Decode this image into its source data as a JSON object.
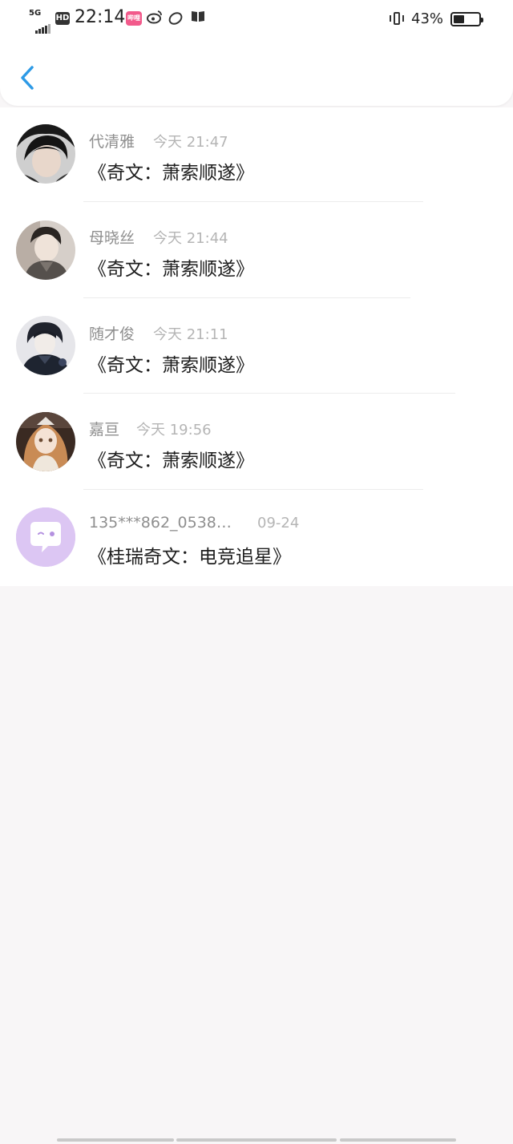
{
  "status_bar": {
    "network": "5G",
    "hd_badge": "HD",
    "time": "22:14",
    "app_badge": "哔哩",
    "battery_percent": "43%",
    "battery_level": 0.43
  },
  "nav": {
    "back_icon": "chevron-left-icon",
    "accent_color": "#2d9ae6"
  },
  "conversations": [
    {
      "name": "代清雅",
      "time": "今天 21:47",
      "message": "《奇文：萧索顺遂》",
      "avatar": "photo-avatar"
    },
    {
      "name": "母晓丝",
      "time": "今天 21:44",
      "message": "《奇文：萧索顺遂》",
      "avatar": "photo-avatar"
    },
    {
      "name": "随才俊",
      "time": "今天 21:11",
      "message": "《奇文：萧索顺遂》",
      "avatar": "photo-avatar"
    },
    {
      "name": "嘉亘",
      "time": "今天 19:56",
      "message": "《奇文：萧索顺遂》",
      "avatar": "doll-photo-avatar"
    },
    {
      "name": "135***862_0538…",
      "time": "09-24",
      "message": "《桂瑞奇文：电竞追星》",
      "avatar": "chat-bubble-avatar"
    }
  ]
}
